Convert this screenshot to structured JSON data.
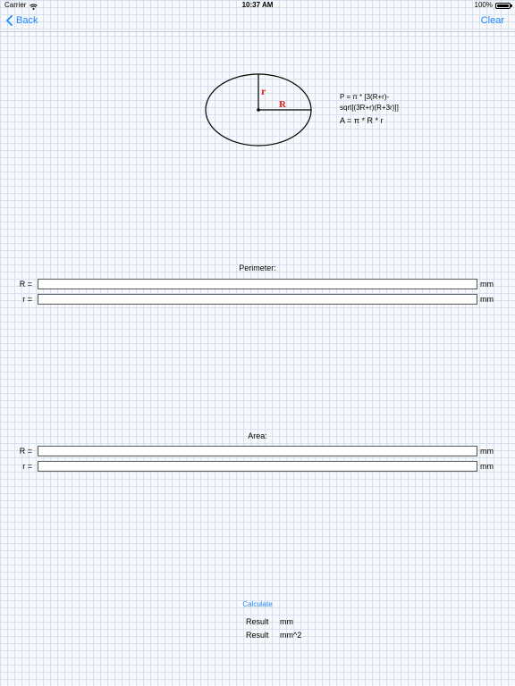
{
  "status_bar": {
    "carrier": "Carrier",
    "time": "10:37 AM",
    "battery": "100%",
    "battery_level": 1.0
  },
  "nav": {
    "back_label": "Back",
    "clear_label": "Clear"
  },
  "diagram": {
    "label_small_radius": "r",
    "label_large_radius": "R",
    "accent_color": "#e0201c"
  },
  "formulas": {
    "perimeter_line1": "P = π * [3(R+r)-",
    "perimeter_line2": "sqrt[(3R+r)(R+3r)]]",
    "area": "A = π * R * r"
  },
  "perimeter": {
    "title": "Perimeter:",
    "R_label": "R =",
    "R_value": "",
    "R_unit": "mm",
    "r_label": "r =",
    "r_value": "",
    "r_unit": "mm"
  },
  "area": {
    "title": "Area:",
    "R_label": "R =",
    "R_value": "",
    "R_unit": "mm",
    "r_label": "r =",
    "r_value": "",
    "r_unit": "mm"
  },
  "calculate_label": "Calculate",
  "results": [
    {
      "label": "Result",
      "unit": "mm"
    },
    {
      "label": "Result",
      "unit": "mm^2"
    }
  ],
  "colors": {
    "link": "#1f87ff",
    "grid_line": "#d6e1ef",
    "background": "#f7f9fc"
  }
}
